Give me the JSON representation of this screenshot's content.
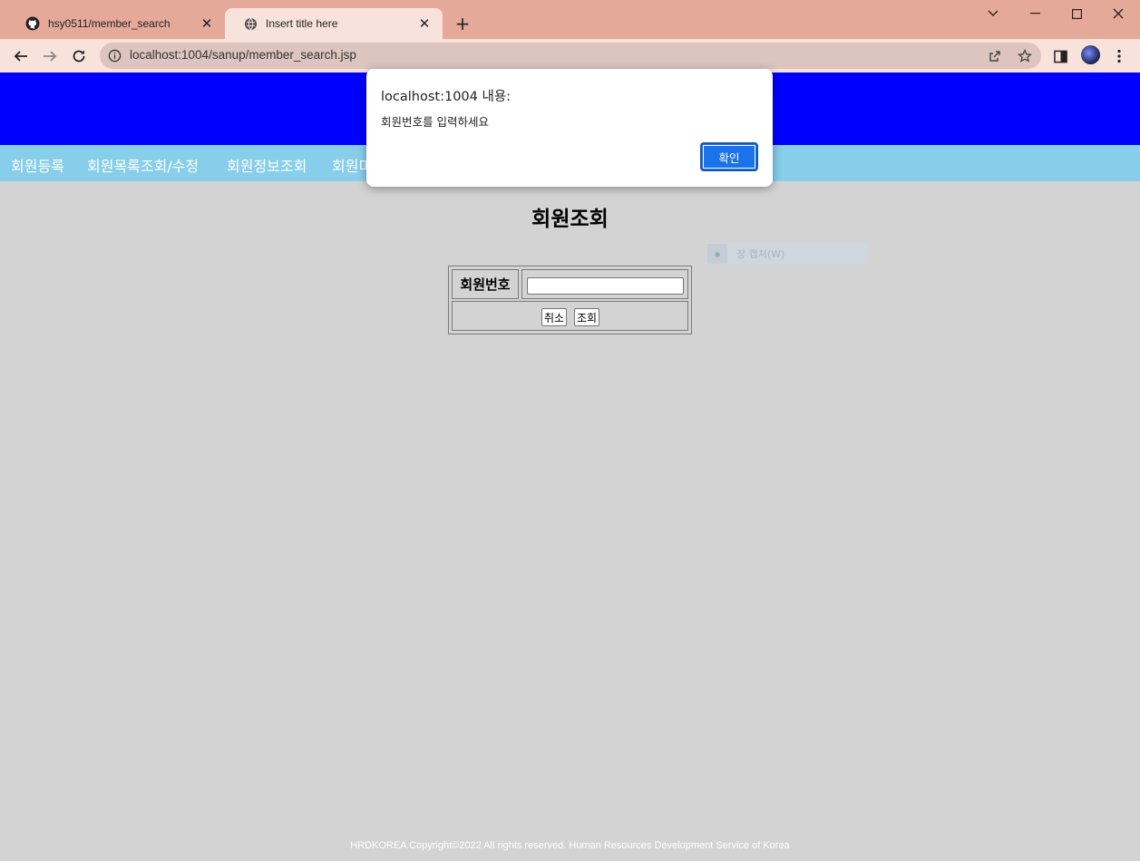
{
  "browser": {
    "tabs": [
      {
        "title": "hsy0511/member_search",
        "favicon": "github-icon",
        "active": false
      },
      {
        "title": "Insert title here",
        "favicon": "globe-icon",
        "active": true
      }
    ],
    "url": "localhost:1004/sanup/member_search.jsp"
  },
  "page": {
    "nav": [
      "회원등록",
      "회원목록조회/수정",
      "회원정보조회",
      "회원미"
    ],
    "heading": "회원조회",
    "form": {
      "label": "회원번호",
      "input_value": "",
      "cancel_label": "취소",
      "search_label": "조회"
    },
    "capture_hint": "장 캡처(W)",
    "footer": "HRDKOREA Copyright©2022 All rights reserved. Human Resources Development Service of Korea"
  },
  "dialog": {
    "title": "localhost:1004 내용:",
    "message": "회원번호를 입력하세요",
    "ok_label": "확인"
  },
  "colors": {
    "tabbar": "#e5a99a",
    "toolbar": "#f8e2dc",
    "header": "#0000ff",
    "nav": "#87ceeb",
    "page_bg": "#d3d3d3",
    "primary_button": "#1a73e8"
  }
}
